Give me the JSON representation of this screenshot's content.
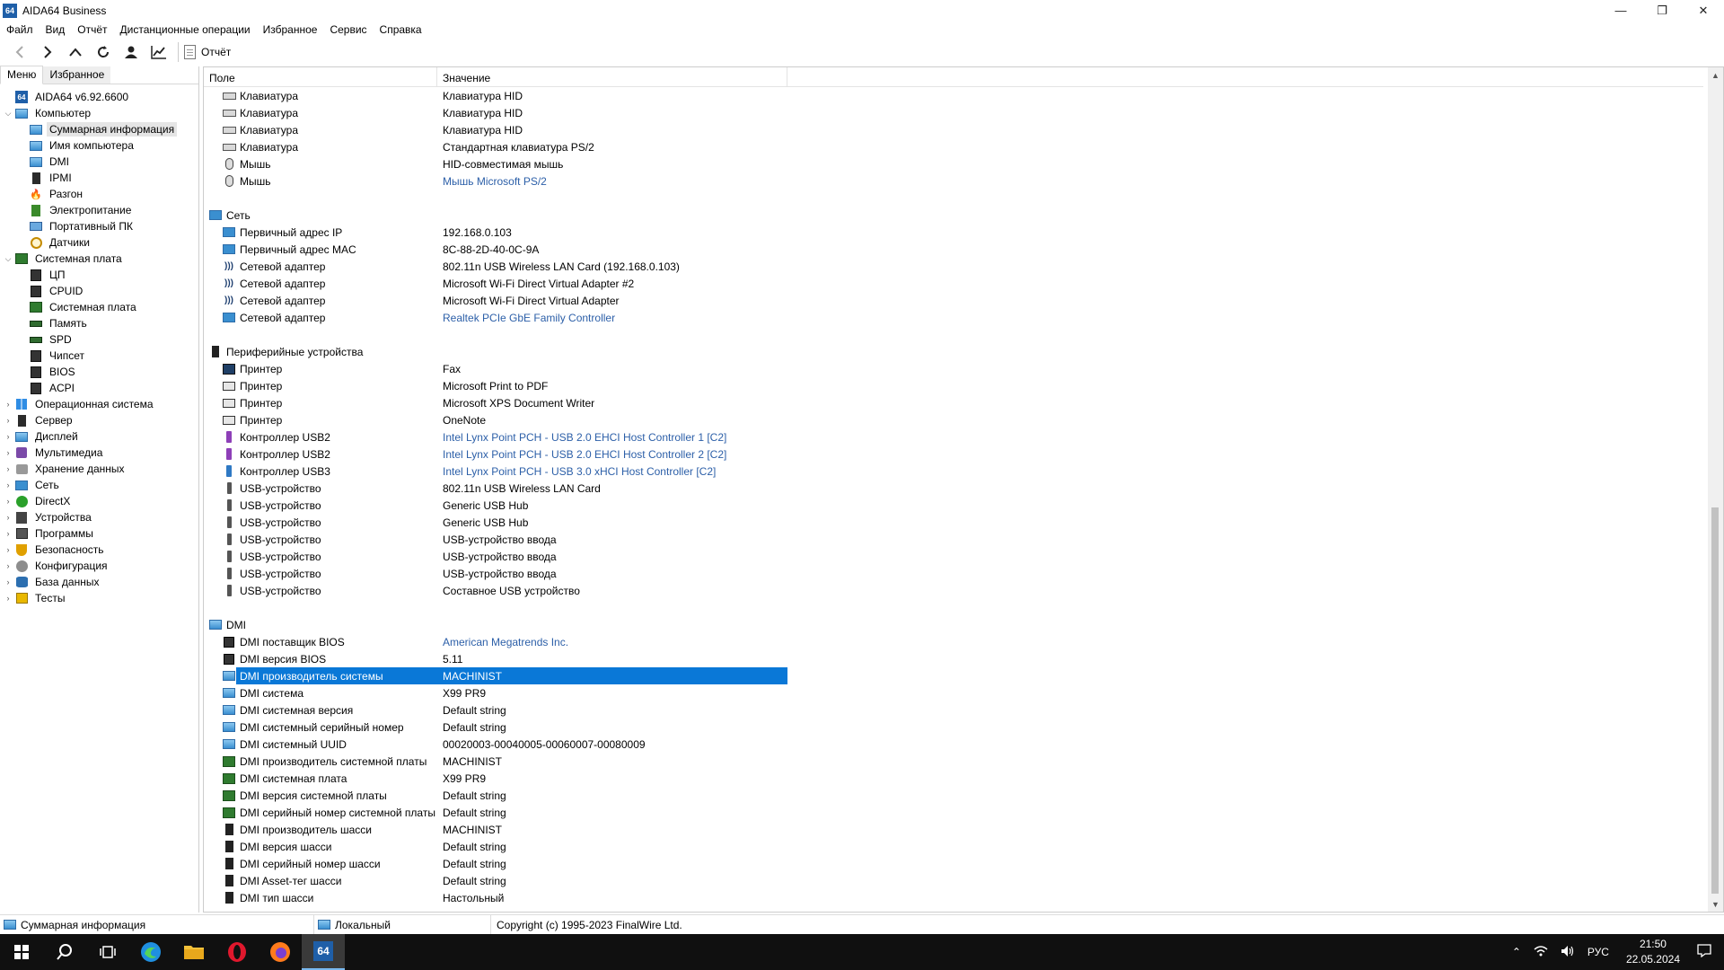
{
  "window": {
    "title": "AIDA64 Business",
    "minimize": "—",
    "maximize": "❐",
    "close": "✕"
  },
  "menu": [
    "Файл",
    "Вид",
    "Отчёт",
    "Дистанционные операции",
    "Избранное",
    "Сервис",
    "Справка"
  ],
  "toolbar": {
    "report_label": "Отчёт"
  },
  "left_tabs": {
    "menu": "Меню",
    "favorites": "Избранное"
  },
  "tree": [
    {
      "level": 0,
      "expander": "",
      "icon": "ic-64",
      "label": "AIDA64 v6.92.6600"
    },
    {
      "level": 0,
      "expander": "⌵",
      "icon": "ic-monitor",
      "label": "Компьютер"
    },
    {
      "level": 1,
      "expander": "",
      "icon": "ic-monitor",
      "label": "Суммарная информация",
      "selected": true
    },
    {
      "level": 1,
      "expander": "",
      "icon": "ic-monitor",
      "label": "Имя компьютера"
    },
    {
      "level": 1,
      "expander": "",
      "icon": "ic-monitor",
      "label": "DMI"
    },
    {
      "level": 1,
      "expander": "",
      "icon": "ic-server",
      "label": "IPMI"
    },
    {
      "level": 1,
      "expander": "",
      "icon": "ic-fire",
      "label": "Разгон"
    },
    {
      "level": 1,
      "expander": "",
      "icon": "ic-power",
      "label": "Электропитание"
    },
    {
      "level": 1,
      "expander": "",
      "icon": "ic-laptop",
      "label": "Портативный ПК"
    },
    {
      "level": 1,
      "expander": "",
      "icon": "ic-gauge",
      "label": "Датчики"
    },
    {
      "level": 0,
      "expander": "⌵",
      "icon": "ic-board",
      "label": "Системная плата"
    },
    {
      "level": 1,
      "expander": "",
      "icon": "ic-chip",
      "label": "ЦП"
    },
    {
      "level": 1,
      "expander": "",
      "icon": "ic-chip",
      "label": "CPUID"
    },
    {
      "level": 1,
      "expander": "",
      "icon": "ic-board",
      "label": "Системная плата"
    },
    {
      "level": 1,
      "expander": "",
      "icon": "ic-ram",
      "label": "Память"
    },
    {
      "level": 1,
      "expander": "",
      "icon": "ic-ram",
      "label": "SPD"
    },
    {
      "level": 1,
      "expander": "",
      "icon": "ic-chip",
      "label": "Чипсет"
    },
    {
      "level": 1,
      "expander": "",
      "icon": "ic-chip",
      "label": "BIOS"
    },
    {
      "level": 1,
      "expander": "",
      "icon": "ic-chip",
      "label": "ACPI"
    },
    {
      "level": 0,
      "expander": "›",
      "icon": "ic-win",
      "label": "Операционная система"
    },
    {
      "level": 0,
      "expander": "›",
      "icon": "ic-server",
      "label": "Сервер"
    },
    {
      "level": 0,
      "expander": "›",
      "icon": "ic-monitor",
      "label": "Дисплей"
    },
    {
      "level": 0,
      "expander": "›",
      "icon": "ic-media",
      "label": "Мультимедиа"
    },
    {
      "level": 0,
      "expander": "›",
      "icon": "ic-storage",
      "label": "Хранение данных"
    },
    {
      "level": 0,
      "expander": "›",
      "icon": "ic-net",
      "label": "Сеть"
    },
    {
      "level": 0,
      "expander": "›",
      "icon": "ic-xbox",
      "label": "DirectX"
    },
    {
      "level": 0,
      "expander": "›",
      "icon": "ic-devices",
      "label": "Устройства"
    },
    {
      "level": 0,
      "expander": "›",
      "icon": "ic-programs",
      "label": "Программы"
    },
    {
      "level": 0,
      "expander": "›",
      "icon": "ic-shield",
      "label": "Безопасность"
    },
    {
      "level": 0,
      "expander": "›",
      "icon": "ic-config",
      "label": "Конфигурация"
    },
    {
      "level": 0,
      "expander": "›",
      "icon": "ic-db",
      "label": "База данных"
    },
    {
      "level": 0,
      "expander": "›",
      "icon": "ic-tests",
      "label": "Тесты"
    }
  ],
  "columns": {
    "field": "Поле",
    "value": "Значение"
  },
  "rows": [
    {
      "type": "item",
      "icon": "ic-kbd",
      "field": "Клавиатура",
      "value": "Клавиатура HID"
    },
    {
      "type": "item",
      "icon": "ic-kbd",
      "field": "Клавиатура",
      "value": "Клавиатура HID"
    },
    {
      "type": "item",
      "icon": "ic-kbd",
      "field": "Клавиатура",
      "value": "Клавиатура HID"
    },
    {
      "type": "item",
      "icon": "ic-kbd",
      "field": "Клавиатура",
      "value": "Стандартная клавиатура PS/2"
    },
    {
      "type": "item",
      "icon": "ic-mouse",
      "field": "Мышь",
      "value": "HID-совместимая мышь"
    },
    {
      "type": "item",
      "icon": "ic-mouse",
      "field": "Мышь",
      "value": "Мышь Microsoft PS/2",
      "link": true
    },
    {
      "type": "blank"
    },
    {
      "type": "section",
      "icon": "ic-net",
      "field": "Сеть"
    },
    {
      "type": "item",
      "icon": "ic-net",
      "field": "Первичный адрес IP",
      "value": "192.168.0.103"
    },
    {
      "type": "item",
      "icon": "ic-net",
      "field": "Первичный адрес MAC",
      "value": "8C-88-2D-40-0C-9A"
    },
    {
      "type": "item",
      "icon": "ic-wifi",
      "field": "Сетевой адаптер",
      "value": "802.11n USB Wireless LAN Card  (192.168.0.103)"
    },
    {
      "type": "item",
      "icon": "ic-wifi",
      "field": "Сетевой адаптер",
      "value": "Microsoft Wi-Fi Direct Virtual Adapter #2"
    },
    {
      "type": "item",
      "icon": "ic-wifi",
      "field": "Сетевой адаптер",
      "value": "Microsoft Wi-Fi Direct Virtual Adapter"
    },
    {
      "type": "item",
      "icon": "ic-net",
      "field": "Сетевой адаптер",
      "value": "Realtek PCIe GbE Family Controller",
      "link": true
    },
    {
      "type": "blank"
    },
    {
      "type": "section",
      "icon": "ic-periph",
      "field": "Периферийные устройства"
    },
    {
      "type": "item",
      "icon": "ic-fax",
      "field": "Принтер",
      "value": "Fax"
    },
    {
      "type": "item",
      "icon": "ic-printer",
      "field": "Принтер",
      "value": "Microsoft Print to PDF"
    },
    {
      "type": "item",
      "icon": "ic-printer",
      "field": "Принтер",
      "value": "Microsoft XPS Document Writer"
    },
    {
      "type": "item",
      "icon": "ic-printer",
      "field": "Принтер",
      "value": "OneNote"
    },
    {
      "type": "item",
      "icon": "ic-usbctl",
      "field": "Контроллер USB2",
      "value": "Intel Lynx Point PCH - USB 2.0 EHCI Host Controller 1 [C2]",
      "link": true
    },
    {
      "type": "item",
      "icon": "ic-usbctl",
      "field": "Контроллер USB2",
      "value": "Intel Lynx Point PCH - USB 2.0 EHCI Host Controller 2 [C2]",
      "link": true
    },
    {
      "type": "item",
      "icon": "ic-usbctl3",
      "field": "Контроллер USB3",
      "value": "Intel Lynx Point PCH - USB 3.0 xHCI Host Controller [C2]",
      "link": true
    },
    {
      "type": "item",
      "icon": "ic-usb",
      "field": "USB-устройство",
      "value": "802.11n USB Wireless LAN Card"
    },
    {
      "type": "item",
      "icon": "ic-usb",
      "field": "USB-устройство",
      "value": "Generic USB Hub"
    },
    {
      "type": "item",
      "icon": "ic-usb",
      "field": "USB-устройство",
      "value": "Generic USB Hub"
    },
    {
      "type": "item",
      "icon": "ic-usb",
      "field": "USB-устройство",
      "value": "USB-устройство ввода"
    },
    {
      "type": "item",
      "icon": "ic-usb",
      "field": "USB-устройство",
      "value": "USB-устройство ввода"
    },
    {
      "type": "item",
      "icon": "ic-usb",
      "field": "USB-устройство",
      "value": "USB-устройство ввода"
    },
    {
      "type": "item",
      "icon": "ic-usb",
      "field": "USB-устройство",
      "value": "Составное USB устройство"
    },
    {
      "type": "blank"
    },
    {
      "type": "section",
      "icon": "ic-monitor",
      "field": "DMI"
    },
    {
      "type": "item",
      "icon": "ic-dmi-chip",
      "field": "DMI поставщик BIOS",
      "value": "American Megatrends Inc.",
      "link": true
    },
    {
      "type": "item",
      "icon": "ic-dmi-chip",
      "field": "DMI версия BIOS",
      "value": "5.11"
    },
    {
      "type": "item",
      "icon": "ic-monitor",
      "field": "DMI производитель системы",
      "value": "MACHINIST",
      "selected": true
    },
    {
      "type": "item",
      "icon": "ic-monitor",
      "field": "DMI система",
      "value": "X99 PR9"
    },
    {
      "type": "item",
      "icon": "ic-monitor",
      "field": "DMI системная версия",
      "value": "Default string"
    },
    {
      "type": "item",
      "icon": "ic-monitor",
      "field": "DMI системный серийный номер",
      "value": "Default string"
    },
    {
      "type": "item",
      "icon": "ic-monitor",
      "field": "DMI системный UUID",
      "value": "00020003-00040005-00060007-00080009"
    },
    {
      "type": "item",
      "icon": "ic-board",
      "field": "DMI производитель системной платы",
      "value": "MACHINIST"
    },
    {
      "type": "item",
      "icon": "ic-board",
      "field": "DMI системная плата",
      "value": "X99 PR9"
    },
    {
      "type": "item",
      "icon": "ic-board",
      "field": "DMI версия системной платы",
      "value": "Default string"
    },
    {
      "type": "item",
      "icon": "ic-board",
      "field": "DMI серийный номер системной платы",
      "value": "Default string"
    },
    {
      "type": "item",
      "icon": "ic-dmi-chassis",
      "field": "DMI производитель шасси",
      "value": "MACHINIST"
    },
    {
      "type": "item",
      "icon": "ic-dmi-chassis",
      "field": "DMI версия шасси",
      "value": "Default string"
    },
    {
      "type": "item",
      "icon": "ic-dmi-chassis",
      "field": "DMI серийный номер шасси",
      "value": "Default string"
    },
    {
      "type": "item",
      "icon": "ic-dmi-chassis",
      "field": "DMI Asset-тег шасси",
      "value": "Default string"
    },
    {
      "type": "item",
      "icon": "ic-dmi-chassis",
      "field": "DMI тип шасси",
      "value": "Настольный"
    }
  ],
  "statusbar": {
    "left": "Суммарная информация",
    "middle": "Локальный",
    "right": "Copyright (c) 1995-2023 FinalWire Ltd."
  },
  "taskbar": {
    "apps": [
      "start",
      "search",
      "task-view",
      "edge",
      "explorer",
      "opera",
      "firefox",
      "aida64"
    ],
    "aida_label": "64",
    "language": "РУС",
    "time": "21:50",
    "date": "22.05.2024"
  },
  "colors": {
    "selection": "#0a78d7",
    "link": "#2c5fa8",
    "taskbar": "#101010"
  }
}
